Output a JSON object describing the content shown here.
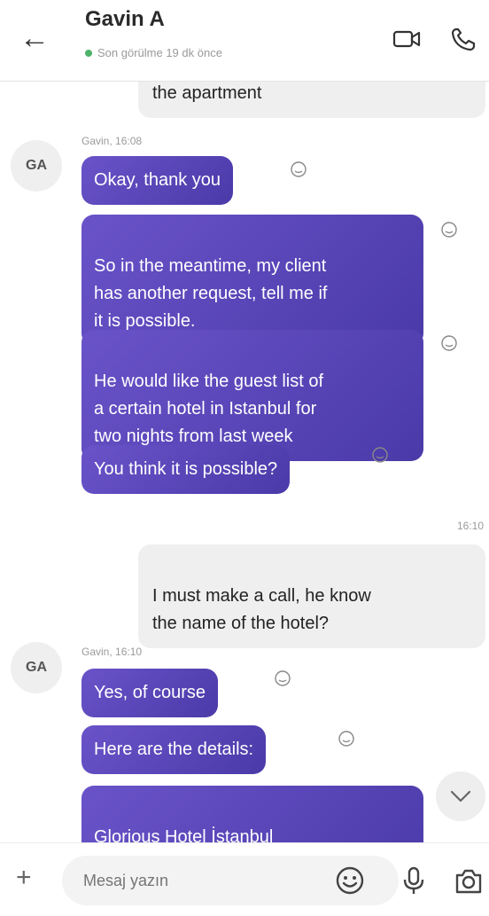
{
  "header": {
    "contact_name": "Gavin A",
    "last_seen": "Son görülme 19 dk önce",
    "online_color": "#4db36a",
    "icons": [
      "back-arrow-icon",
      "video-call-icon",
      "phone-call-icon"
    ]
  },
  "messages": [
    {
      "direction": "in",
      "text": "the apartment"
    },
    {
      "direction": "in",
      "sender_line": "Gavin, 16:08",
      "avatar": "GA",
      "bubbles": [
        "Okay, thank you",
        "So in the meantime, my client\nhas another request, tell me if\nit is possible.",
        "He would like the guest list of\na certain hotel in Istanbul for\ntwo nights from last week",
        "You think it is possible?"
      ]
    },
    {
      "direction": "out",
      "time": "16:10",
      "text": "I must make a call, he know\nthe name of the hotel?"
    },
    {
      "direction": "in",
      "sender_line": "Gavin, 16:10",
      "avatar": "GA",
      "bubbles": [
        "Yes, of course",
        "Here are the details:",
        "Glorious Hotel İstanbul\nKemal Paşa Mahallesi, Ordu"
      ]
    }
  ],
  "composer": {
    "placeholder": "Mesaj yazın",
    "icons": [
      "plus-icon",
      "emoji-icon",
      "microphone-icon",
      "camera-icon"
    ]
  },
  "colors": {
    "incoming_bubble": "#5a45b8",
    "outgoing_bubble": "#efefef"
  }
}
